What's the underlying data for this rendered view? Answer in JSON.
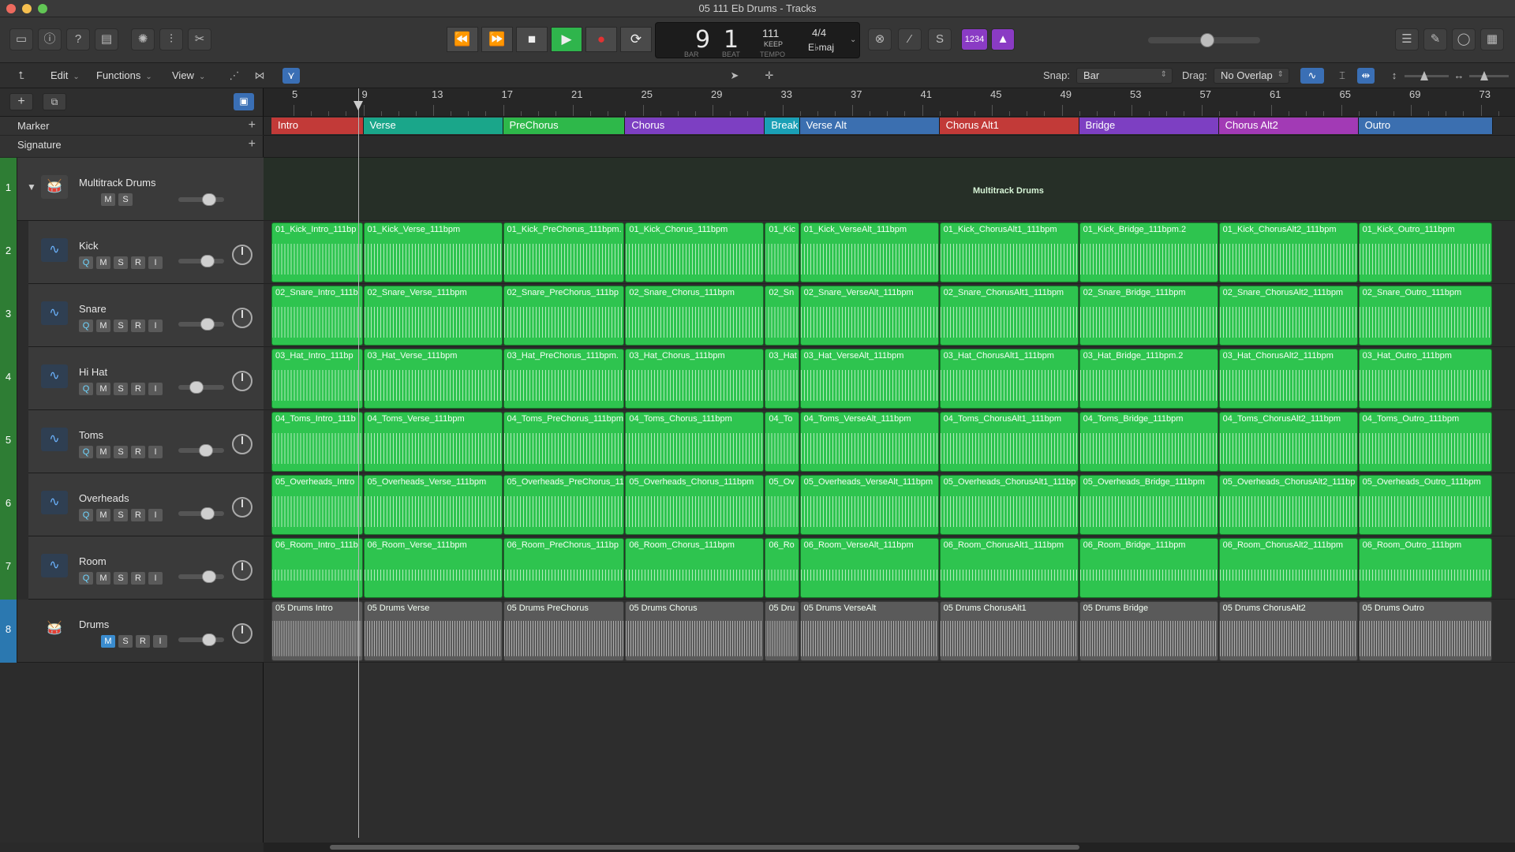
{
  "window": {
    "title": "05 111 Eb Drums - Tracks",
    "traffic_colors": [
      "#ed6a5e",
      "#f5bf4f",
      "#62c655"
    ]
  },
  "transport": {
    "bar": "9",
    "beat": "1",
    "bar_label": "BAR",
    "beat_label": "BEAT",
    "tempo": "111",
    "tempo_mode": "KEEP",
    "tempo_label": "TEMPO",
    "time_signature": "4/4",
    "key": "E♭maj",
    "count_in": "1234"
  },
  "menus": {
    "edit": "Edit",
    "functions": "Functions",
    "view": "View"
  },
  "snap": {
    "label": "Snap:",
    "value": "Bar"
  },
  "drag": {
    "label": "Drag:",
    "value": "No Overlap"
  },
  "ruler": {
    "bars": [
      "5",
      "9",
      "13",
      "17",
      "21",
      "25",
      "29",
      "33",
      "37",
      "41",
      "45",
      "49",
      "53",
      "57",
      "61",
      "65",
      "69",
      "73"
    ]
  },
  "global_tracks": {
    "marker": "Marker",
    "signature": "Signature"
  },
  "markers": [
    {
      "name": "Intro",
      "color": "#c23a38"
    },
    {
      "name": "Verse",
      "color": "#1aa68a"
    },
    {
      "name": "PreChorus",
      "color": "#2eb84a"
    },
    {
      "name": "Chorus",
      "color": "#7d3fc2"
    },
    {
      "name": "Break",
      "color": "#1aa0b6"
    },
    {
      "name": "Verse Alt",
      "color": "#3b6fb0"
    },
    {
      "name": "Chorus Alt1",
      "color": "#c23a38"
    },
    {
      "name": "Bridge",
      "color": "#7d3fc2"
    },
    {
      "name": "Chorus Alt2",
      "color": "#a23ab5"
    },
    {
      "name": "Outro",
      "color": "#3b6fb0"
    }
  ],
  "folder_track": {
    "number": "1",
    "name": "Multitrack Drums",
    "region_label": "Multitrack Drums"
  },
  "tracks": [
    {
      "number": "2",
      "name": "Kick",
      "regions": [
        "01_Kick_Intro_111bp",
        "01_Kick_Verse_111bpm",
        "01_Kick_PreChorus_111bpm.",
        "01_Kick_Chorus_111bpm",
        "01_Kic",
        "01_Kick_VerseAlt_111bpm",
        "01_Kick_ChorusAlt1_111bpm",
        "01_Kick_Bridge_111bpm.2",
        "01_Kick_ChorusAlt2_111bpm",
        "01_Kick_Outro_111bpm"
      ]
    },
    {
      "number": "3",
      "name": "Snare",
      "regions": [
        "02_Snare_Intro_111b",
        "02_Snare_Verse_111bpm",
        "02_Snare_PreChorus_111bp",
        "02_Snare_Chorus_111bpm",
        "02_Sn",
        "02_Snare_VerseAlt_111bpm",
        "02_Snare_ChorusAlt1_111bpm",
        "02_Snare_Bridge_111bpm",
        "02_Snare_ChorusAlt2_111bpm",
        "02_Snare_Outro_111bpm"
      ]
    },
    {
      "number": "4",
      "name": "Hi Hat",
      "regions": [
        "03_Hat_Intro_111bp",
        "03_Hat_Verse_111bpm",
        "03_Hat_PreChorus_111bpm.",
        "03_Hat_Chorus_111bpm",
        "03_Hat",
        "03_Hat_VerseAlt_111bpm",
        "03_Hat_ChorusAlt1_111bpm",
        "03_Hat_Bridge_111bpm.2",
        "03_Hat_ChorusAlt2_111bpm",
        "03_Hat_Outro_111bpm"
      ]
    },
    {
      "number": "5",
      "name": "Toms",
      "regions": [
        "04_Toms_Intro_111b",
        "04_Toms_Verse_111bpm",
        "04_Toms_PreChorus_111bpm",
        "04_Toms_Chorus_111bpm",
        "04_To",
        "04_Toms_VerseAlt_111bpm",
        "04_Toms_ChorusAlt1_111bpm",
        "04_Toms_Bridge_111bpm",
        "04_Toms_ChorusAlt2_111bpm",
        "04_Toms_Outro_111bpm"
      ]
    },
    {
      "number": "6",
      "name": "Overheads",
      "regions": [
        "05_Overheads_Intro",
        "05_Overheads_Verse_111bpm",
        "05_Overheads_PreChorus_11",
        "05_Overheads_Chorus_111bpm",
        "05_Ov",
        "05_Overheads_VerseAlt_111bpm",
        "05_Overheads_ChorusAlt1_111bp",
        "05_Overheads_Bridge_111bpm",
        "05_Overheads_ChorusAlt2_111bp",
        "05_Overheads_Outro_111bpm"
      ]
    },
    {
      "number": "7",
      "name": "Room",
      "regions": [
        "06_Room_Intro_111b",
        "06_Room_Verse_111bpm",
        "06_Room_PreChorus_111bp",
        "06_Room_Chorus_111bpm",
        "06_Ro",
        "06_Room_VerseAlt_111bpm",
        "06_Room_ChorusAlt1_111bpm",
        "06_Room_Bridge_111bpm",
        "06_Room_ChorusAlt2_111bpm",
        "06_Room_Outro_111bpm"
      ]
    },
    {
      "number": "8",
      "name": "Drums",
      "regions": [
        "05 Drums Intro",
        "05 Drums Verse",
        "05 Drums PreChorus",
        "05 Drums Chorus",
        "05 Dru",
        "05 Drums VerseAlt",
        "05 Drums ChorusAlt1",
        "05 Drums Bridge",
        "05 Drums ChorusAlt2",
        "05 Drums Outro"
      ]
    }
  ],
  "button_labels": {
    "q": "Q",
    "m": "M",
    "s": "S",
    "r": "R",
    "i": "I"
  }
}
